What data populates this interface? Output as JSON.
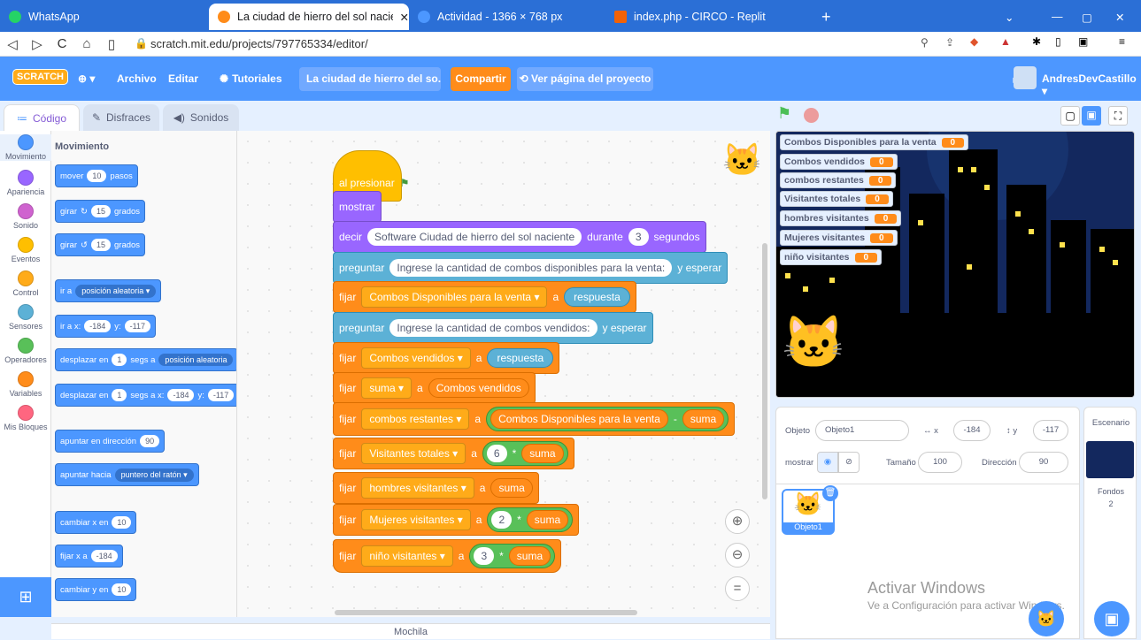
{
  "browser": {
    "tabs": [
      {
        "label": "WhatsApp",
        "color": "#25d366"
      },
      {
        "label": "La ciudad de hierro del sol nacien",
        "color": "#ff8c1a"
      },
      {
        "label": "Actividad - 1366 × 768 px",
        "color": "#4c97ff"
      },
      {
        "label": "index.php - CIRCO - Replit",
        "color": "#f26207"
      }
    ],
    "url": "scratch.mit.edu/projects/797765334/editor/",
    "new_tab": "+"
  },
  "menu": {
    "logo": "SCRATCH",
    "archivo": "Archivo",
    "editar": "Editar",
    "tutoriales": "Tutoriales",
    "project_title": "La ciudad de hierro del so...",
    "compartir": "Compartir",
    "ver_pagina": "Ver página del proyecto",
    "user": "AndresDevCastillo"
  },
  "editor_tabs": {
    "codigo": "Código",
    "disfraces": "Disfraces",
    "sonidos": "Sonidos"
  },
  "categories": [
    {
      "label": "Movimiento",
      "color": "#4c97ff"
    },
    {
      "label": "Apariencia",
      "color": "#9966ff"
    },
    {
      "label": "Sonido",
      "color": "#cf63cf"
    },
    {
      "label": "Eventos",
      "color": "#ffbf00"
    },
    {
      "label": "Control",
      "color": "#ffab19"
    },
    {
      "label": "Sensores",
      "color": "#5cb1d6"
    },
    {
      "label": "Operadores",
      "color": "#59c059"
    },
    {
      "label": "Variables",
      "color": "#ff8c1a"
    },
    {
      "label": "Mis Bloques",
      "color": "#ff6680"
    }
  ],
  "palette": {
    "heading": "Movimiento",
    "mover": "mover",
    "mover_val": "10",
    "pasos": "pasos",
    "girar": "girar",
    "girar_val": "15",
    "grados": "grados",
    "ir_a": "ir a",
    "posicion_aleatoria": "posición aleatoria",
    "ir_a_x": "ir a x:",
    "x_val": "-184",
    "y_label": "y:",
    "y_val": "-117",
    "desplazar_en": "desplazar en",
    "uno": "1",
    "segs_a": "segs a",
    "segs_a_x": "segs a x:",
    "y_trunc": "-117",
    "apuntar_en": "apuntar en dirección",
    "dir_val": "90",
    "apuntar_hacia": "apuntar hacia",
    "puntero": "puntero del ratón",
    "cambiar_x": "cambiar x en",
    "fijar_x": "fijar x a",
    "cambiar_y": "cambiar y en",
    "diez": "10"
  },
  "script": {
    "hat": "al presionar",
    "mostrar": "mostrar",
    "decir": "decir",
    "decir_text": "Software Ciudad de hierro del sol naciente",
    "durante": "durante",
    "segundos_val": "3",
    "segundos": "segundos",
    "preguntar": "preguntar",
    "pregunta1": "Ingrese la cantidad de combos disponibles para la venta:",
    "y_esperar": "y esperar",
    "fijar": "fijar",
    "a": "a",
    "respuesta": "respuesta",
    "pregunta2": "Ingrese la cantidad de combos vendidos:",
    "var_combos_disp": "Combos Disponibles para la venta",
    "var_combos_vend": "Combos vendidos",
    "var_suma": "suma",
    "var_combos_rest": "combos restantes",
    "minus": "-",
    "var_visit_tot": "Visitantes totales",
    "times": "*",
    "six": "6",
    "var_hombres": "hombres visitantes",
    "var_mujeres": "Mujeres visitantes",
    "two": "2",
    "var_ninos": "niño visitantes",
    "three": "3"
  },
  "monitors": [
    {
      "label": "Combos Disponibles para la venta",
      "value": "0"
    },
    {
      "label": "Combos vendidos",
      "value": "0"
    },
    {
      "label": "combos restantes",
      "value": "0"
    },
    {
      "label": "Visitantes totales",
      "value": "0"
    },
    {
      "label": "hombres visitantes",
      "value": "0"
    },
    {
      "label": "Mujeres visitantes",
      "value": "0"
    },
    {
      "label": "niño visitantes",
      "value": "0"
    }
  ],
  "sprite": {
    "objeto_label": "Objeto",
    "objeto_name": "Objeto1",
    "x_label": "x",
    "x": "-184",
    "y_label": "y",
    "y": "-117",
    "mostrar": "mostrar",
    "tamano_label": "Tamaño",
    "tamano": "100",
    "direccion_label": "Dirección",
    "direccion": "90",
    "thumb_name": "Objeto1"
  },
  "stage_pane": {
    "title": "Escenario",
    "fondos_label": "Fondos",
    "fondos": "2"
  },
  "watermark": {
    "line1": "Activar Windows",
    "line2": "Ve a Configuración para activar Windows."
  },
  "mochila": "Mochila"
}
